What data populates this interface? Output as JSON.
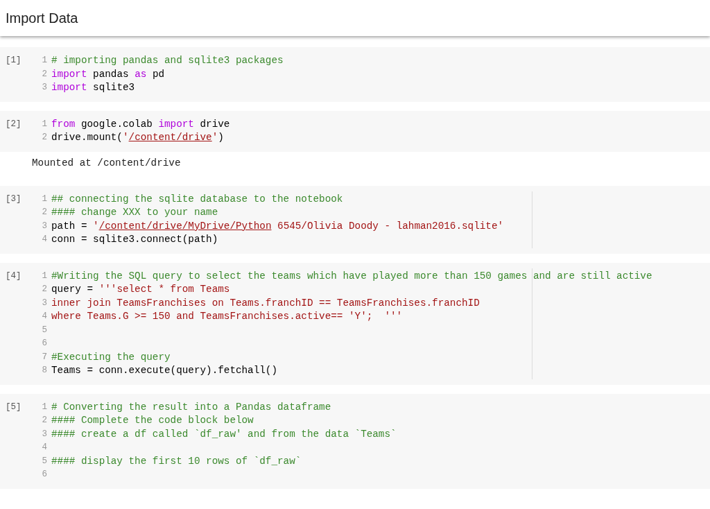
{
  "header": {
    "title": "Import Data"
  },
  "cells": [
    {
      "execution_count": "[1]",
      "ruler": false,
      "lines": [
        {
          "number": "1",
          "tokens": [
            {
              "kind": "comment",
              "text": "# importing pandas and sqlite3 packages"
            }
          ]
        },
        {
          "number": "2",
          "tokens": [
            {
              "kind": "keyword",
              "text": "import"
            },
            {
              "kind": "plain",
              "text": " pandas "
            },
            {
              "kind": "keyword",
              "text": "as"
            },
            {
              "kind": "plain",
              "text": " pd"
            }
          ]
        },
        {
          "number": "3",
          "tokens": [
            {
              "kind": "keyword",
              "text": "import"
            },
            {
              "kind": "plain",
              "text": " sqlite3"
            }
          ]
        }
      ]
    },
    {
      "execution_count": "[2]",
      "ruler": false,
      "lines": [
        {
          "number": "1",
          "tokens": [
            {
              "kind": "keyword",
              "text": "from"
            },
            {
              "kind": "plain",
              "text": " google.colab "
            },
            {
              "kind": "keyword",
              "text": "import"
            },
            {
              "kind": "plain",
              "text": " drive"
            }
          ]
        },
        {
          "number": "2",
          "tokens": [
            {
              "kind": "plain",
              "text": "drive.mount("
            },
            {
              "kind": "string",
              "text": "'"
            },
            {
              "kind": "link",
              "text": "/content/drive"
            },
            {
              "kind": "string",
              "text": "'"
            },
            {
              "kind": "plain",
              "text": ")"
            }
          ]
        }
      ],
      "output": "Mounted at /content/drive"
    },
    {
      "execution_count": "[3]",
      "ruler": true,
      "lines": [
        {
          "number": "1",
          "tokens": [
            {
              "kind": "comment",
              "text": "## connecting the sqlite database to the notebook"
            }
          ]
        },
        {
          "number": "2",
          "tokens": [
            {
              "kind": "comment",
              "text": "#### change XXX to your name"
            }
          ]
        },
        {
          "number": "3",
          "tokens": [
            {
              "kind": "plain",
              "text": "path = "
            },
            {
              "kind": "string",
              "text": "'"
            },
            {
              "kind": "link",
              "text": "/content/drive/MyDrive/Python"
            },
            {
              "kind": "string",
              "text": " 6545/Olivia Doody - lahman2016.sqlite'"
            }
          ]
        },
        {
          "number": "4",
          "tokens": [
            {
              "kind": "plain",
              "text": "conn = sqlite3.connect(path)"
            }
          ]
        }
      ]
    },
    {
      "execution_count": "[4]",
      "ruler": true,
      "lines": [
        {
          "number": "1",
          "tokens": [
            {
              "kind": "comment",
              "text": "#Writing the SQL query to select the teams which have played more than 150 games and are still active"
            }
          ]
        },
        {
          "number": "2",
          "tokens": [
            {
              "kind": "plain",
              "text": "query = "
            },
            {
              "kind": "string",
              "text": "'''select * from Teams"
            }
          ]
        },
        {
          "number": "3",
          "tokens": [
            {
              "kind": "string",
              "text": "inner join TeamsFranchises on Teams.franchID == TeamsFranchises.franchID"
            }
          ]
        },
        {
          "number": "4",
          "tokens": [
            {
              "kind": "string",
              "text": "where Teams.G >= 150 and TeamsFranchises.active== 'Y';  '''"
            }
          ]
        },
        {
          "number": "5"
        },
        {
          "number": "6"
        },
        {
          "number": "7",
          "tokens": [
            {
              "kind": "comment",
              "text": "#Executing the query"
            }
          ]
        },
        {
          "number": "8",
          "tokens": [
            {
              "kind": "plain",
              "text": "Teams = conn.execute(query).fetchall()"
            }
          ]
        }
      ]
    },
    {
      "execution_count": "[5]",
      "ruler": false,
      "lines": [
        {
          "number": "1",
          "tokens": [
            {
              "kind": "comment",
              "text": "# Converting the result into a Pandas dataframe"
            }
          ]
        },
        {
          "number": "2",
          "tokens": [
            {
              "kind": "comment",
              "text": "#### Complete the code block below"
            }
          ]
        },
        {
          "number": "3",
          "tokens": [
            {
              "kind": "comment",
              "text": "#### create a df called `df_raw' and from the data `Teams`"
            }
          ]
        },
        {
          "number": "4"
        },
        {
          "number": "5",
          "tokens": [
            {
              "kind": "comment",
              "text": "#### display the first 10 rows of `df_raw`"
            }
          ]
        },
        {
          "number": "6"
        }
      ]
    }
  ]
}
